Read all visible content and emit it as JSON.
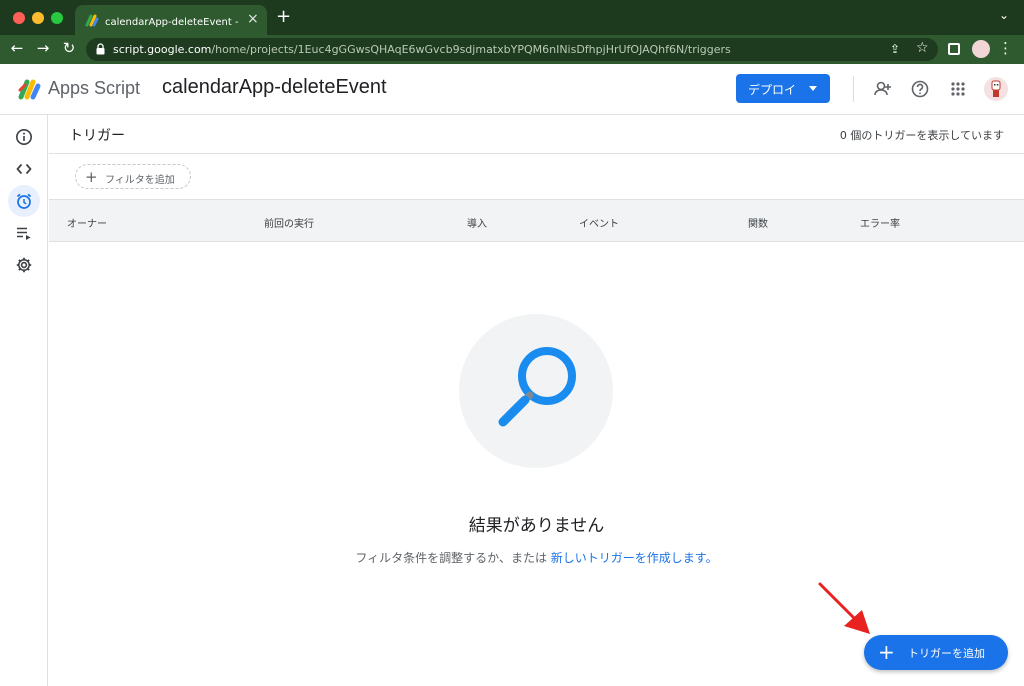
{
  "browser": {
    "tab_title": "calendarApp-deleteEvent - プロ",
    "url_host": "script.google.com",
    "url_path": "/home/projects/1Euc4gGGwsQHAqE6wGvcb9sdjmatxbYPQM6nINisDfhpjHrUfOJAQhf6N/triggers"
  },
  "header": {
    "app_name": "Apps Script",
    "project_title": "calendarApp-deleteEvent",
    "deploy_label": "デプロイ"
  },
  "rail": {
    "items": [
      {
        "name": "overview",
        "icon": "info-icon"
      },
      {
        "name": "editor",
        "icon": "code-icon"
      },
      {
        "name": "triggers",
        "icon": "alarm-clock-icon",
        "active": true
      },
      {
        "name": "executions",
        "icon": "playlist-play-icon"
      },
      {
        "name": "settings",
        "icon": "gear-icon"
      }
    ]
  },
  "main": {
    "title": "トリガー",
    "count_text": "0 個のトリガーを表示しています",
    "filter_label": "フィルタを追加",
    "columns": [
      "オーナー",
      "前回の実行",
      "導入",
      "イベント",
      "関数",
      "エラー率"
    ],
    "empty_title": "結果がありません",
    "empty_text_prefix": "フィルタ条件を調整するか、または ",
    "empty_link": "新しいトリガーを作成します。",
    "fab_label": "トリガーを追加"
  },
  "colors": {
    "accent": "#1a73e8",
    "browser_frame": "#1d3a1f",
    "annotation_arrow": "#e8231f"
  }
}
